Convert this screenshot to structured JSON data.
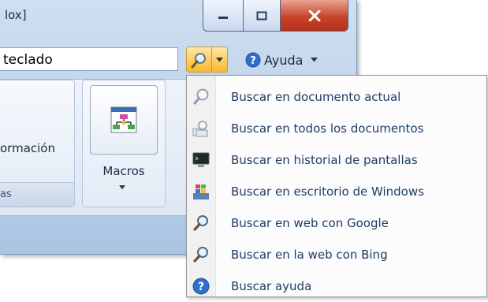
{
  "window": {
    "title": "lox]"
  },
  "search": {
    "value": "teclado"
  },
  "help": {
    "label": "Ayuda"
  },
  "ribbon": {
    "info_label": "ormación",
    "group_label": "as",
    "macros_label": "Macros"
  },
  "menu": {
    "items": [
      {
        "label": "Buscar en documento actual",
        "icon": "magnifier-icon"
      },
      {
        "label": "Buscar en todos los documentos",
        "icon": "multi-document-search-icon"
      },
      {
        "label": "Buscar en historial de pantallas",
        "icon": "screen-history-icon"
      },
      {
        "label": "Buscar en escritorio de Windows",
        "icon": "windows-desktop-icon"
      },
      {
        "label": "Buscar en web con Google",
        "icon": "web-search-icon"
      },
      {
        "label": "Buscar en la web con Bing",
        "icon": "web-search-icon"
      },
      {
        "label": "Buscar ayuda",
        "icon": "help-icon"
      }
    ]
  },
  "colors": {
    "accent": "#f8b737",
    "close": "#c8442b",
    "menu_text": "#1e3d66"
  }
}
